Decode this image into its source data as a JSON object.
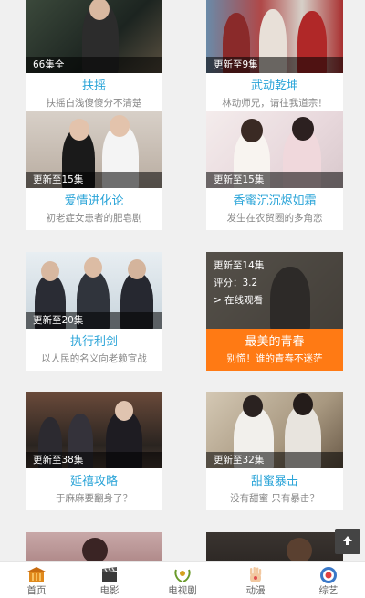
{
  "cards": [
    {
      "episode": "66集全",
      "title": "扶摇",
      "desc": "扶摇白浅傻傻分不清楚"
    },
    {
      "episode": "更新至9集",
      "title": "武动乾坤",
      "desc": "林动师兄，请往我道宗！"
    },
    {
      "episode": "更新至15集",
      "title": "爱情进化论",
      "desc": "初老症女患者的肥皂剧"
    },
    {
      "episode": "更新至15集",
      "title": "香蜜沉沉烬如霜",
      "desc": "发生在农贸圈的多角恋"
    },
    {
      "episode": "更新至20集",
      "title": "执行利剑",
      "desc": "以人民的名义向老赖宣战"
    },
    {
      "episode": "更新至14集",
      "rating": "评分：3.2",
      "watch": "> 在线观看",
      "title": "最美的青春",
      "desc": "别慌！谁的青春不迷茫"
    },
    {
      "episode": "更新至38集",
      "title": "延禧攻略",
      "desc": "于麻麻要翻身了？"
    },
    {
      "episode": "更新至32集",
      "title": "甜蜜暴击",
      "desc": "没有甜蜜 只有暴击？"
    }
  ],
  "tabbar": [
    {
      "label": "首页",
      "icon": "home-icon"
    },
    {
      "label": "电影",
      "icon": "clapperboard-icon"
    },
    {
      "label": "电视剧",
      "icon": "tv-icon"
    },
    {
      "label": "动漫",
      "icon": "anime-icon"
    },
    {
      "label": "综艺",
      "icon": "variety-icon"
    }
  ],
  "back_to_top": {
    "icon": "arrow-up-icon"
  },
  "colors": {
    "title": "#2aa4d8",
    "active": "#ff7a14",
    "background": "#f0f0f0"
  }
}
